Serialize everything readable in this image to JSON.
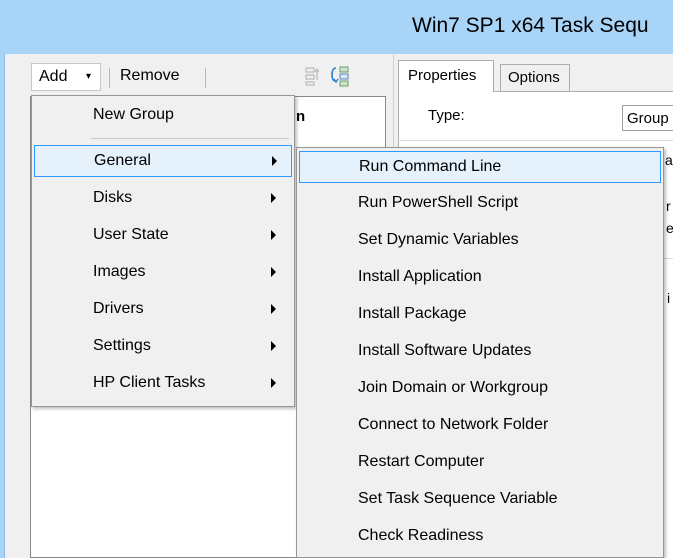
{
  "window": {
    "title": "Win7 SP1 x64 Task Sequ"
  },
  "toolbar": {
    "add_label": "Add",
    "remove_label": "Remove",
    "add_arrow": "▾"
  },
  "tree": {
    "header_fragment": "n"
  },
  "tabs": {
    "properties": "Properties",
    "options": "Options"
  },
  "properties": {
    "type_label": "Type:",
    "type_value": "Group",
    "partial_text": [
      "al",
      "r",
      "e",
      "i"
    ]
  },
  "add_menu": {
    "items": [
      {
        "label": "New Group",
        "submenu": false
      },
      {
        "label": "General",
        "submenu": true
      },
      {
        "label": "Disks",
        "submenu": true
      },
      {
        "label": "User State",
        "submenu": true
      },
      {
        "label": "Images",
        "submenu": true
      },
      {
        "label": "Drivers",
        "submenu": true
      },
      {
        "label": "Settings",
        "submenu": true
      },
      {
        "label": "HP Client Tasks",
        "submenu": true
      }
    ],
    "highlighted": "General"
  },
  "general_submenu": {
    "items": [
      "Run Command Line",
      "Run PowerShell Script",
      "Set Dynamic Variables",
      "Install Application",
      "Install Package",
      "Install Software Updates",
      "Join Domain or Workgroup",
      "Connect to Network Folder",
      "Restart Computer",
      "Set Task Sequence Variable",
      "Check Readiness"
    ],
    "highlighted": "Run Command Line"
  },
  "colors": {
    "titlebar": "#a8d4f7",
    "menu_bg": "#f0f0f0",
    "highlight_bg": "#e5f1fb",
    "highlight_border": "#3399ff"
  }
}
